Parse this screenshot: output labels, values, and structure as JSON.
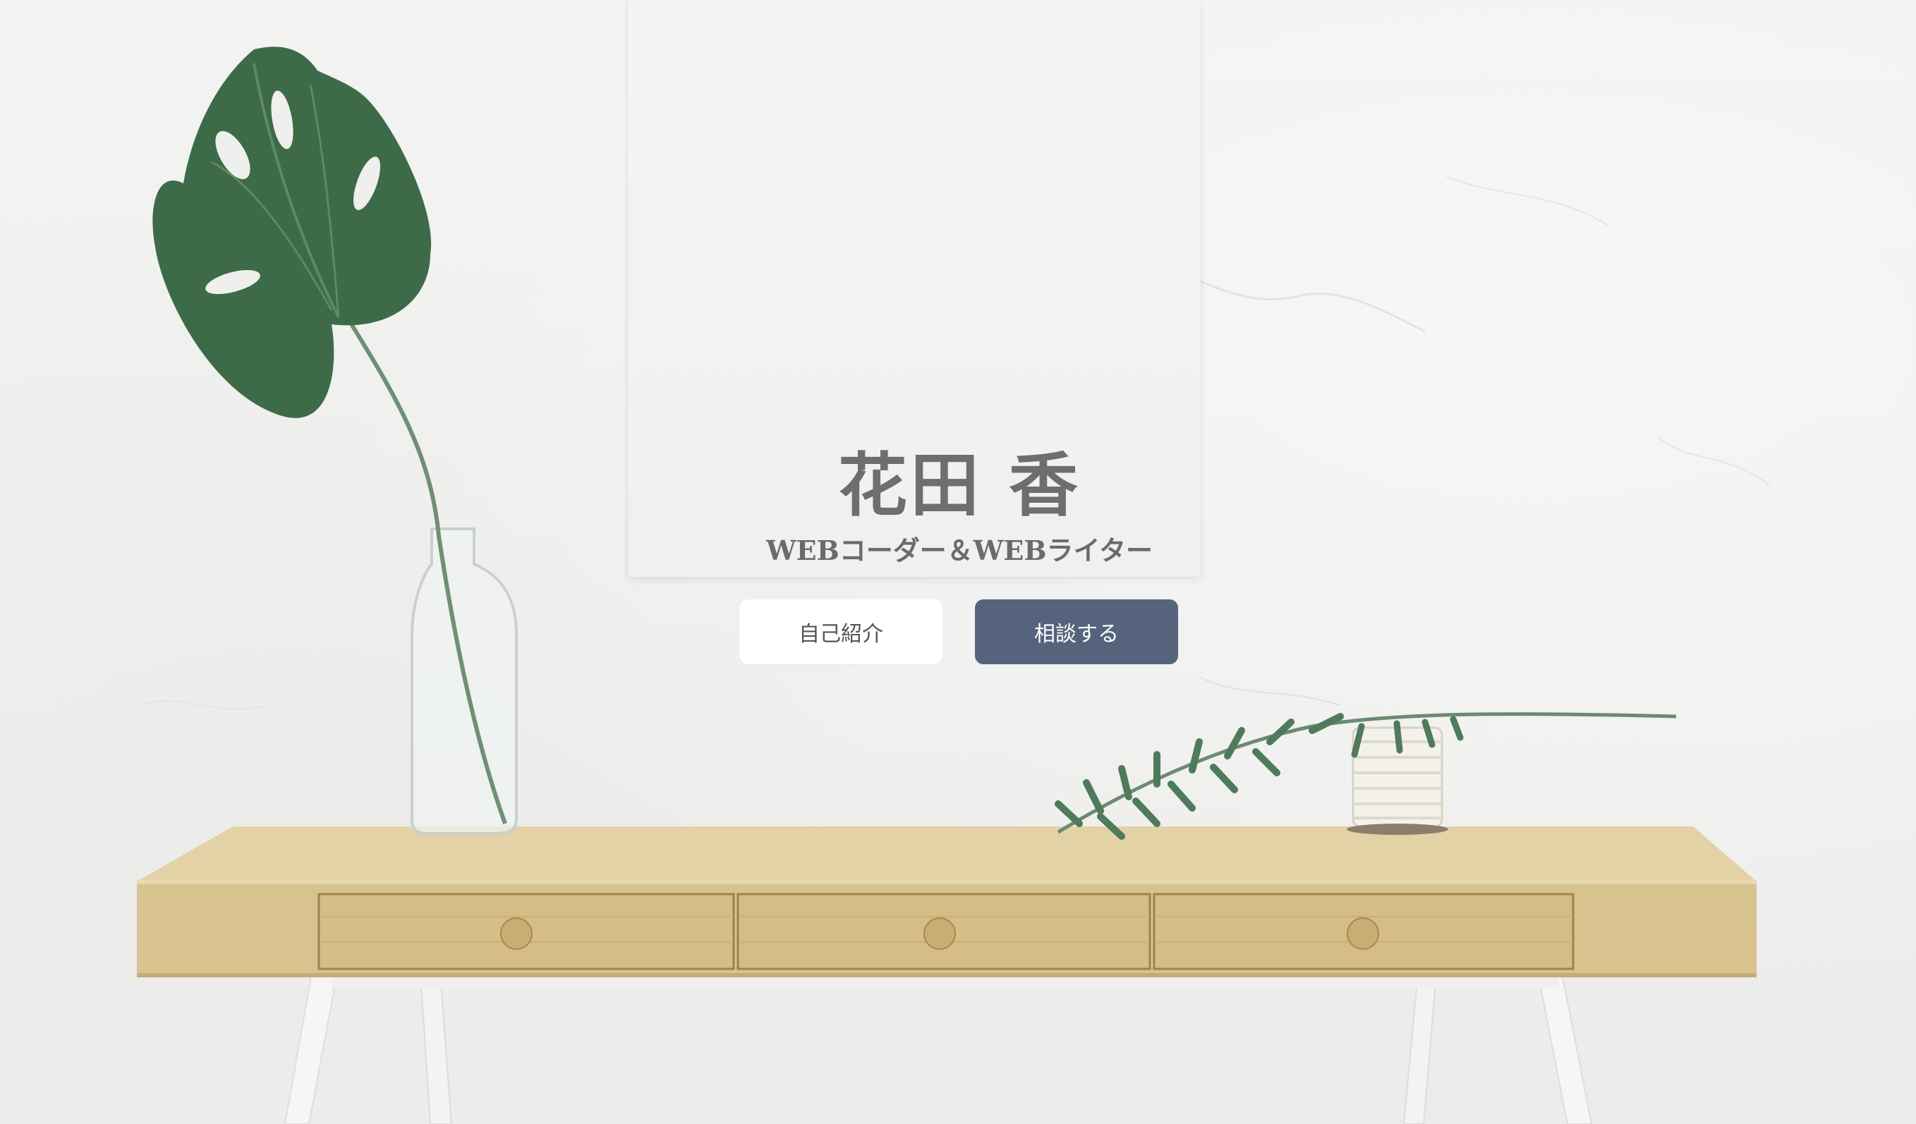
{
  "hero": {
    "name": "花田 香",
    "subtitle": "WEBコーダー＆WEBライター",
    "buttons": {
      "about_label": "自己紹介",
      "contact_label": "相談する"
    }
  },
  "colors": {
    "wall": "#f1f1f0",
    "poster": "#f2f2f2",
    "text": "#6e6e6e",
    "contact_button": "#55647c",
    "about_button": "#ffffff",
    "desk_wood": "#d9c493",
    "leaf": "#3d6b47"
  }
}
